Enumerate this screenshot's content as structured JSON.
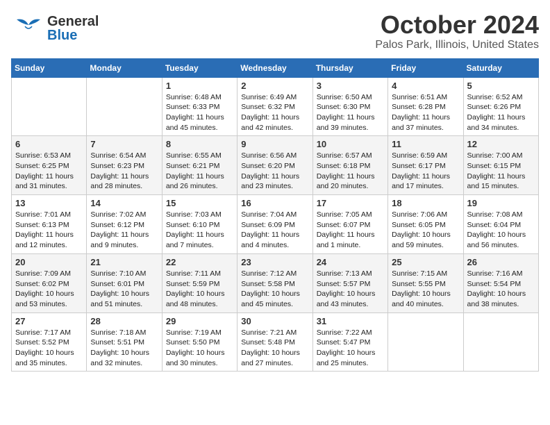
{
  "header": {
    "logo": {
      "line1": "General",
      "line2": "Blue"
    },
    "title": "October 2024",
    "location": "Palos Park, Illinois, United States"
  },
  "days_of_week": [
    "Sunday",
    "Monday",
    "Tuesday",
    "Wednesday",
    "Thursday",
    "Friday",
    "Saturday"
  ],
  "weeks": [
    [
      {
        "day": "",
        "info": ""
      },
      {
        "day": "",
        "info": ""
      },
      {
        "day": "1",
        "info": "Sunrise: 6:48 AM\nSunset: 6:33 PM\nDaylight: 11 hours and 45 minutes."
      },
      {
        "day": "2",
        "info": "Sunrise: 6:49 AM\nSunset: 6:32 PM\nDaylight: 11 hours and 42 minutes."
      },
      {
        "day": "3",
        "info": "Sunrise: 6:50 AM\nSunset: 6:30 PM\nDaylight: 11 hours and 39 minutes."
      },
      {
        "day": "4",
        "info": "Sunrise: 6:51 AM\nSunset: 6:28 PM\nDaylight: 11 hours and 37 minutes."
      },
      {
        "day": "5",
        "info": "Sunrise: 6:52 AM\nSunset: 6:26 PM\nDaylight: 11 hours and 34 minutes."
      }
    ],
    [
      {
        "day": "6",
        "info": "Sunrise: 6:53 AM\nSunset: 6:25 PM\nDaylight: 11 hours and 31 minutes."
      },
      {
        "day": "7",
        "info": "Sunrise: 6:54 AM\nSunset: 6:23 PM\nDaylight: 11 hours and 28 minutes."
      },
      {
        "day": "8",
        "info": "Sunrise: 6:55 AM\nSunset: 6:21 PM\nDaylight: 11 hours and 26 minutes."
      },
      {
        "day": "9",
        "info": "Sunrise: 6:56 AM\nSunset: 6:20 PM\nDaylight: 11 hours and 23 minutes."
      },
      {
        "day": "10",
        "info": "Sunrise: 6:57 AM\nSunset: 6:18 PM\nDaylight: 11 hours and 20 minutes."
      },
      {
        "day": "11",
        "info": "Sunrise: 6:59 AM\nSunset: 6:17 PM\nDaylight: 11 hours and 17 minutes."
      },
      {
        "day": "12",
        "info": "Sunrise: 7:00 AM\nSunset: 6:15 PM\nDaylight: 11 hours and 15 minutes."
      }
    ],
    [
      {
        "day": "13",
        "info": "Sunrise: 7:01 AM\nSunset: 6:13 PM\nDaylight: 11 hours and 12 minutes."
      },
      {
        "day": "14",
        "info": "Sunrise: 7:02 AM\nSunset: 6:12 PM\nDaylight: 11 hours and 9 minutes."
      },
      {
        "day": "15",
        "info": "Sunrise: 7:03 AM\nSunset: 6:10 PM\nDaylight: 11 hours and 7 minutes."
      },
      {
        "day": "16",
        "info": "Sunrise: 7:04 AM\nSunset: 6:09 PM\nDaylight: 11 hours and 4 minutes."
      },
      {
        "day": "17",
        "info": "Sunrise: 7:05 AM\nSunset: 6:07 PM\nDaylight: 11 hours and 1 minute."
      },
      {
        "day": "18",
        "info": "Sunrise: 7:06 AM\nSunset: 6:05 PM\nDaylight: 10 hours and 59 minutes."
      },
      {
        "day": "19",
        "info": "Sunrise: 7:08 AM\nSunset: 6:04 PM\nDaylight: 10 hours and 56 minutes."
      }
    ],
    [
      {
        "day": "20",
        "info": "Sunrise: 7:09 AM\nSunset: 6:02 PM\nDaylight: 10 hours and 53 minutes."
      },
      {
        "day": "21",
        "info": "Sunrise: 7:10 AM\nSunset: 6:01 PM\nDaylight: 10 hours and 51 minutes."
      },
      {
        "day": "22",
        "info": "Sunrise: 7:11 AM\nSunset: 5:59 PM\nDaylight: 10 hours and 48 minutes."
      },
      {
        "day": "23",
        "info": "Sunrise: 7:12 AM\nSunset: 5:58 PM\nDaylight: 10 hours and 45 minutes."
      },
      {
        "day": "24",
        "info": "Sunrise: 7:13 AM\nSunset: 5:57 PM\nDaylight: 10 hours and 43 minutes."
      },
      {
        "day": "25",
        "info": "Sunrise: 7:15 AM\nSunset: 5:55 PM\nDaylight: 10 hours and 40 minutes."
      },
      {
        "day": "26",
        "info": "Sunrise: 7:16 AM\nSunset: 5:54 PM\nDaylight: 10 hours and 38 minutes."
      }
    ],
    [
      {
        "day": "27",
        "info": "Sunrise: 7:17 AM\nSunset: 5:52 PM\nDaylight: 10 hours and 35 minutes."
      },
      {
        "day": "28",
        "info": "Sunrise: 7:18 AM\nSunset: 5:51 PM\nDaylight: 10 hours and 32 minutes."
      },
      {
        "day": "29",
        "info": "Sunrise: 7:19 AM\nSunset: 5:50 PM\nDaylight: 10 hours and 30 minutes."
      },
      {
        "day": "30",
        "info": "Sunrise: 7:21 AM\nSunset: 5:48 PM\nDaylight: 10 hours and 27 minutes."
      },
      {
        "day": "31",
        "info": "Sunrise: 7:22 AM\nSunset: 5:47 PM\nDaylight: 10 hours and 25 minutes."
      },
      {
        "day": "",
        "info": ""
      },
      {
        "day": "",
        "info": ""
      }
    ]
  ]
}
